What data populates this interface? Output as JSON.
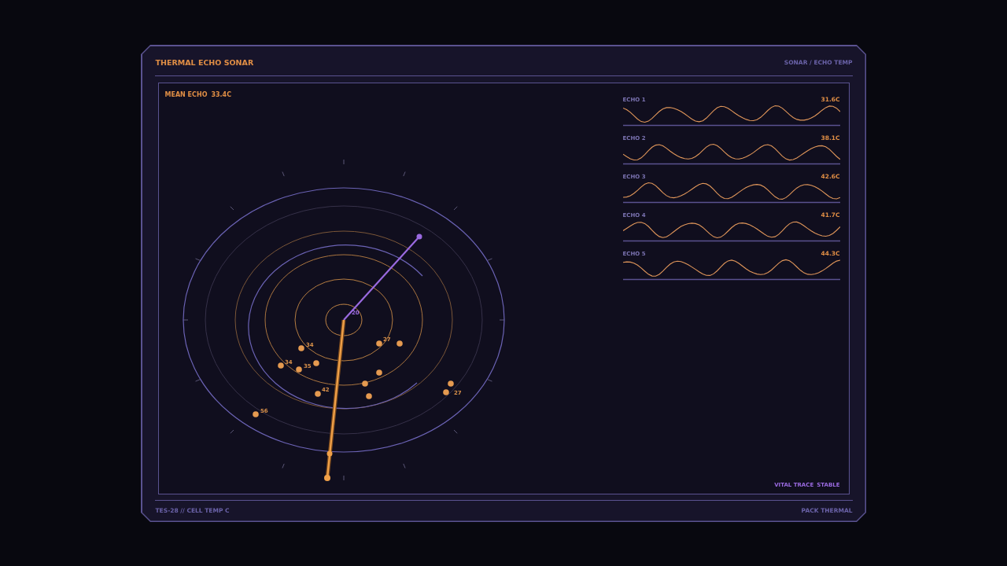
{
  "header": {
    "title": "THERMAL ECHO SONAR",
    "breadcrumb": "SONAR / ECHO TEMP"
  },
  "readout": {
    "label": "MEAN ECHO",
    "value": "33.4C"
  },
  "radar": {
    "center_label": "20",
    "blip_labels": [
      "34",
      "34",
      "35",
      "42",
      "56",
      "27",
      "27"
    ]
  },
  "traces": [
    {
      "label": "ECHO 1",
      "value": "31.6C"
    },
    {
      "label": "ECHO 2",
      "value": "38.1C"
    },
    {
      "label": "ECHO 3",
      "value": "42.6C"
    },
    {
      "label": "ECHO 4",
      "value": "41.7C"
    },
    {
      "label": "ECHO 5",
      "value": "44.3C"
    }
  ],
  "status": {
    "label": "VITAL TRACE",
    "value": "STABLE"
  },
  "footer": {
    "left": "TES-28 // CELL TEMP C",
    "right": "PACK THERMAL"
  }
}
